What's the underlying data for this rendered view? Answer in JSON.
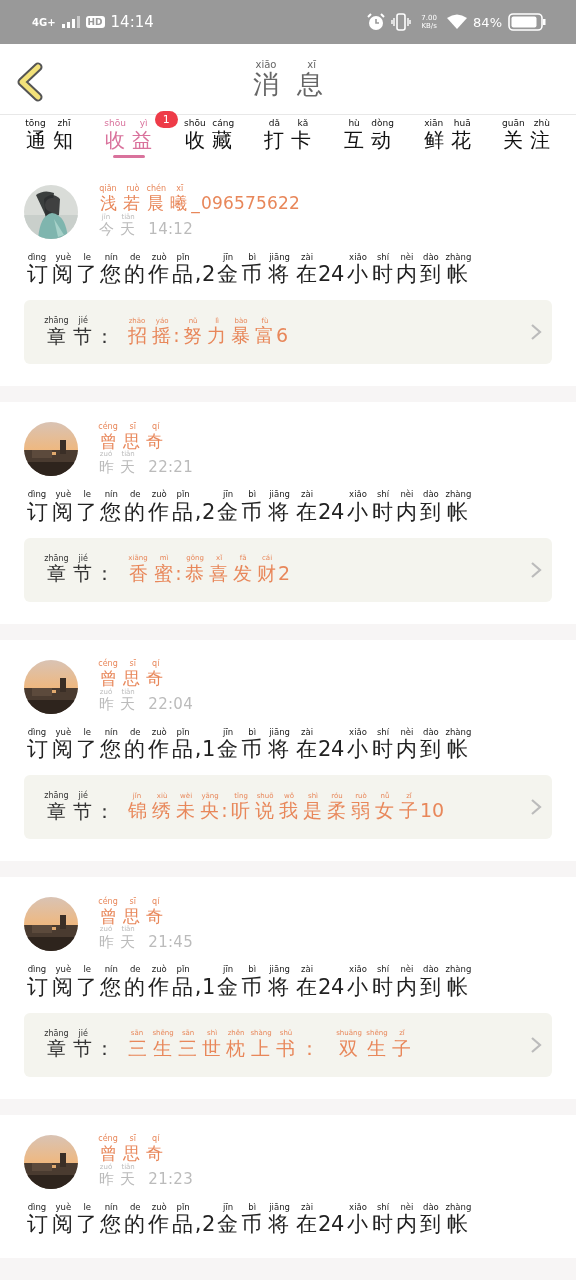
{
  "status_bar": {
    "network": "4G+",
    "hd": "HD",
    "time": "14:14",
    "speed": "7.00 KB/s",
    "battery": "84%"
  },
  "header": {
    "title": {
      "text": "消息",
      "pinyin": "xiāo xī"
    }
  },
  "tabs": [
    {
      "label": {
        "text": "通知",
        "pinyin": "tōng zhī"
      },
      "selected": false
    },
    {
      "label": {
        "text": "收益",
        "pinyin": "shōu yì"
      },
      "selected": true,
      "badge": "1"
    },
    {
      "label": {
        "text": "收藏",
        "pinyin": "shōu cáng"
      },
      "selected": false
    },
    {
      "label": {
        "text": "打卡",
        "pinyin": "dǎ kǎ"
      },
      "selected": false
    },
    {
      "label": {
        "text": "互动",
        "pinyin": "hù dòng"
      },
      "selected": false
    },
    {
      "label": {
        "text": "鲜花",
        "pinyin": "xiān huā"
      },
      "selected": false
    },
    {
      "label": {
        "text": "关注",
        "pinyin": "guān zhù"
      },
      "selected": false
    }
  ],
  "messages": [
    {
      "name": {
        "text": "浅若晨曦_096575622",
        "pinyin": "qiǎn ruò chén xī"
      },
      "time": {
        "text": "今天 14:12",
        "pinyin": "jīn tiān"
      },
      "body": {
        "text": "订阅了您的作品,2金币将在24小时内到帐",
        "pinyin": "dìng yuè le nín de zuò pǐn jīn bì jiāng zài xiǎo shí nèi dào zhàng"
      },
      "chapter_label": {
        "text": "章节：",
        "pinyin": "zhāng jié"
      },
      "chapter": {
        "text": "招摇:努力暴富6",
        "pinyin": "zhāo yáo nǔ lì bào fù"
      }
    },
    {
      "name": {
        "text": "曾思奇",
        "pinyin": "céng sī qí"
      },
      "time": {
        "text": "昨天 22:21",
        "pinyin": "zuó tiān"
      },
      "body": {
        "text": "订阅了您的作品,2金币将在24小时内到帐",
        "pinyin": "dìng yuè le nín de zuò pǐn jīn bì jiāng zài xiǎo shí nèi dào zhàng"
      },
      "chapter_label": {
        "text": "章节：",
        "pinyin": "zhāng jié"
      },
      "chapter": {
        "text": "香蜜:恭喜发财2",
        "pinyin": "xiāng mì gōng xǐ fā cái"
      }
    },
    {
      "name": {
        "text": "曾思奇",
        "pinyin": "céng sī qí"
      },
      "time": {
        "text": "昨天 22:04",
        "pinyin": "zuó tiān"
      },
      "body": {
        "text": "订阅了您的作品,1金币将在24小时内到帐",
        "pinyin": "dìng yuè le nín de zuò pǐn jīn bì jiāng zài xiǎo shí nèi dào zhàng"
      },
      "chapter_label": {
        "text": "章节：",
        "pinyin": "zhāng jié"
      },
      "chapter": {
        "text": "锦绣未央:听说我是柔弱女子10",
        "pinyin": "jǐn xiù wèi yāng tīng shuō wǒ shì róu ruò nǚ zǐ"
      }
    },
    {
      "name": {
        "text": "曾思奇",
        "pinyin": "céng sī qí"
      },
      "time": {
        "text": "昨天 21:45",
        "pinyin": "zuó tiān"
      },
      "body": {
        "text": "订阅了您的作品,1金币将在24小时内到帐",
        "pinyin": "dìng yuè le nín de zuò pǐn jīn bì jiāng zài xiǎo shí nèi dào zhàng"
      },
      "chapter_label": {
        "text": "章节：",
        "pinyin": "zhāng jié"
      },
      "chapter": {
        "text": "三生三世枕上书： 双生子",
        "pinyin": "sān shēng sān shì zhěn shàng shū shuāng shēng zǐ"
      }
    },
    {
      "name": {
        "text": "曾思奇",
        "pinyin": "céng sī qí"
      },
      "time": {
        "text": "昨天 21:23",
        "pinyin": "zuó tiān"
      },
      "body": {
        "text": "订阅了您的作品,2金币将在24小时内到帐",
        "pinyin": "dìng yuè le nín de zuò pǐn jīn bì jiāng zài xiǎo shí nèi dào zhàng"
      }
    }
  ]
}
